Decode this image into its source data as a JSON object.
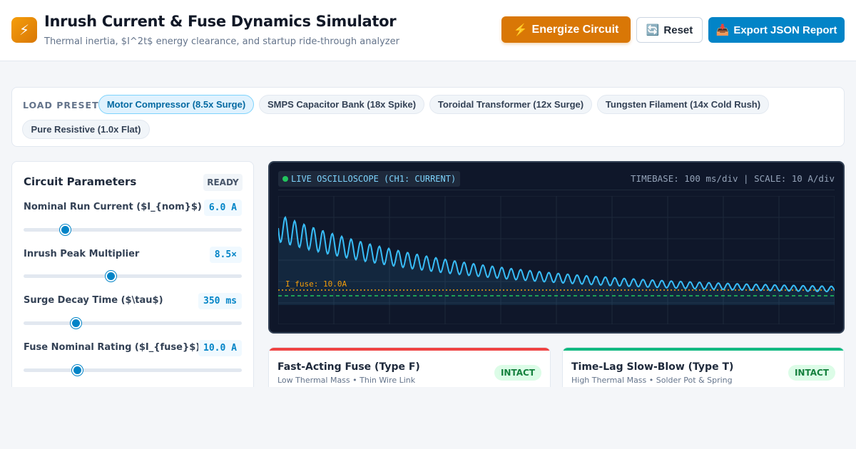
{
  "header": {
    "logo_icon": "⚡",
    "title": "Inrush Current & Fuse Dynamics Simulator",
    "subtitle": "Thermal inertia, $I^2t$ energy clearance, and startup ride-through analyzer",
    "buttons": {
      "energize": {
        "icon": "⚡",
        "label": "Energize Circuit"
      },
      "reset": {
        "icon": "🔄",
        "label": "Reset"
      },
      "export": {
        "icon": "📥",
        "label": "Export JSON Report"
      }
    }
  },
  "presets": {
    "label": "LOAD PRESET:",
    "items": [
      {
        "label": "Motor Compressor (8.5x Surge)",
        "active": true
      },
      {
        "label": "SMPS Capacitor Bank (18x Spike)",
        "active": false
      },
      {
        "label": "Toroidal Transformer (12x Surge)",
        "active": false
      },
      {
        "label": "Tungsten Filament (14x Cold Rush)",
        "active": false
      },
      {
        "label": "Pure Resistive (1.0x Flat)",
        "active": false
      }
    ]
  },
  "params": {
    "title": "Circuit Parameters",
    "status": "READY",
    "items": [
      {
        "label": "Nominal Run Current ($I_{nom}$)",
        "value": "6.0 A",
        "fraction": 0.19
      },
      {
        "label": "Inrush Peak Multiplier",
        "value": "8.5×",
        "fraction": 0.4
      },
      {
        "label": "Surge Decay Time ($\\tau$)",
        "value": "350 ms",
        "fraction": 0.24
      },
      {
        "label": "Fuse Nominal Rating ($I_{fuse}$)",
        "value": "10.0 A",
        "fraction": 0.245
      }
    ]
  },
  "scope": {
    "badge": "LIVE OSCILLOSCOPE (CH1: CURRENT)",
    "info": "TIMEBASE: 100 ms/div | SCALE: 10 A/div",
    "fuse_line_label": "I_fuse: 10.0A",
    "colors": {
      "trace": "#38bdf8",
      "fuse_line": "#f59e0b",
      "nominal_line": "#22c55e",
      "grid": "#1e293b"
    }
  },
  "fuses": [
    {
      "name": "Fast-Acting Fuse (Type F)",
      "desc": "Low Thermal Mass • Thin Wire Link",
      "status": "INTACT",
      "accent": "#ef4444"
    },
    {
      "name": "Time-Lag Slow-Blow (Type T)",
      "desc": "High Thermal Mass • Solder Pot & Spring",
      "status": "INTACT",
      "accent": "#10b981"
    }
  ]
}
